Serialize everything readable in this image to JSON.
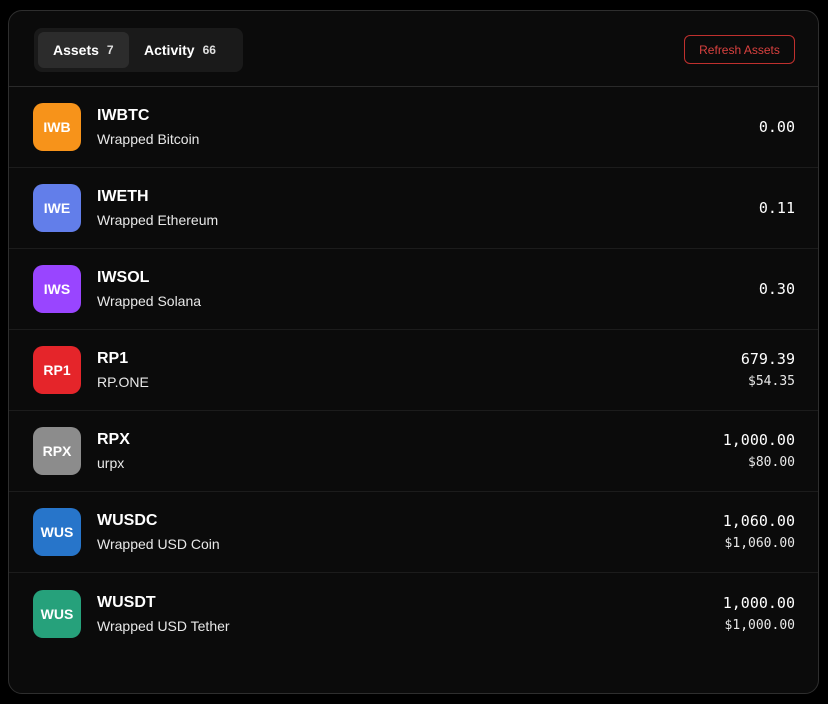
{
  "tabs": [
    {
      "label": "Assets",
      "count": "7"
    },
    {
      "label": "Activity",
      "count": "66"
    }
  ],
  "refresh_label": "Refresh Assets",
  "assets": [
    {
      "icon_text": "IWB",
      "icon_color": "#f7931a",
      "symbol": "IWBTC",
      "name": "Wrapped Bitcoin",
      "balance": "0.00",
      "usd": ""
    },
    {
      "icon_text": "IWE",
      "icon_color": "#627eea",
      "symbol": "IWETH",
      "name": "Wrapped Ethereum",
      "balance": "0.11",
      "usd": ""
    },
    {
      "icon_text": "IWS",
      "icon_color": "#9945ff",
      "symbol": "IWSOL",
      "name": "Wrapped Solana",
      "balance": "0.30",
      "usd": ""
    },
    {
      "icon_text": "RP1",
      "icon_color": "#e5252a",
      "symbol": "RP1",
      "name": "RP.ONE",
      "balance": "679.39",
      "usd": "$54.35"
    },
    {
      "icon_text": "RPX",
      "icon_color": "#8c8c8c",
      "symbol": "RPX",
      "name": "urpx",
      "balance": "1,000.00",
      "usd": "$80.00"
    },
    {
      "icon_text": "WUS",
      "icon_color": "#2775ca",
      "symbol": "WUSDC",
      "name": "Wrapped USD Coin",
      "balance": "1,060.00",
      "usd": "$1,060.00"
    },
    {
      "icon_text": "WUS",
      "icon_color": "#26a17b",
      "symbol": "WUSDT",
      "name": "Wrapped USD Tether",
      "balance": "1,000.00",
      "usd": "$1,000.00"
    }
  ]
}
